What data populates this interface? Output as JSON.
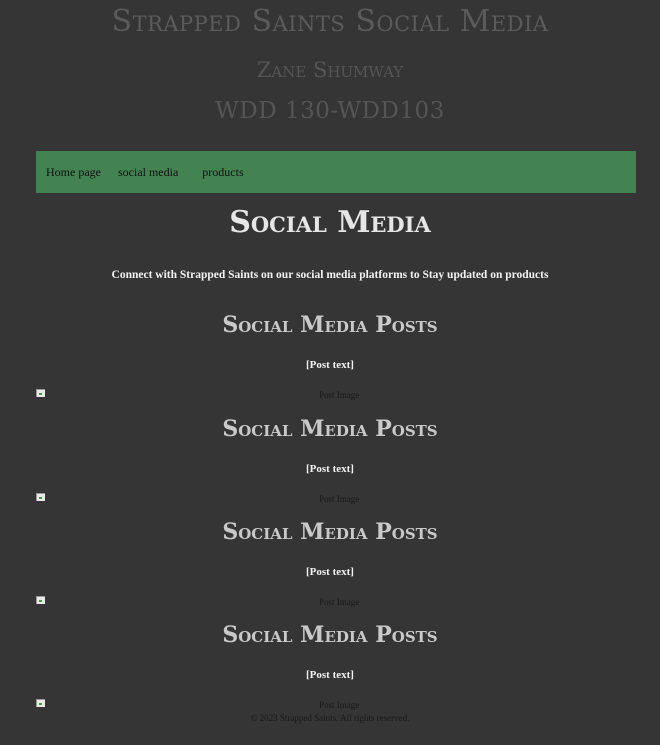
{
  "header": {
    "site_title": "Strapped Saints Social Media",
    "author": "Zane Shumway",
    "course": "WDD 130-WDD103"
  },
  "nav": {
    "home": "Home page",
    "social": "social media",
    "products": "products"
  },
  "main": {
    "title": "Social Media",
    "intro": "Connect with Strapped Saints on our social media platforms to Stay updated on products"
  },
  "posts": [
    {
      "heading": "Social Media Posts",
      "text": "[Post text]",
      "image_alt": "Post Image"
    },
    {
      "heading": "Social Media Posts",
      "text": "[Post text]",
      "image_alt": "Post Image"
    },
    {
      "heading": "Social Media Posts",
      "text": "[Post text]",
      "image_alt": "Post Image"
    },
    {
      "heading": "Social Media Posts",
      "text": "[Post text]",
      "image_alt": "Post Image"
    }
  ],
  "footer": {
    "copyright": "© 2023 Strapped Saints. All rights reserved."
  },
  "colors": {
    "background": "#353535",
    "nav": "#438351"
  }
}
